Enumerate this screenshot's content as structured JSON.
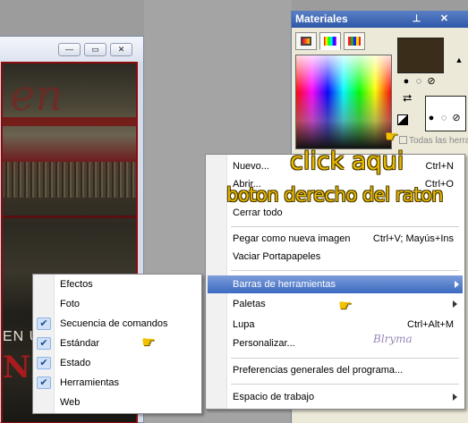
{
  "doc_window": {
    "buttons": [
      "—",
      "▭",
      "✕"
    ],
    "text_fragments": {
      "top": "en",
      "middle": "EN U",
      "bottom": "NI"
    }
  },
  "materials": {
    "title": "Materiales",
    "titlebar_icons": [
      "pin-icon",
      "close-icon"
    ],
    "tabs": [
      "frame-tab",
      "rainbow-tab",
      "swatches-tab"
    ],
    "fg_color": "#3a2e1a",
    "bg_color": "#ffffff",
    "todas_label": "Todas las herra"
  },
  "context_menu": {
    "items": [
      {
        "label": "Nuevo...",
        "shortcut": "Ctrl+N"
      },
      {
        "label": "Abrir...",
        "shortcut": "Ctrl+O"
      },
      {
        "label": "Cerrar todo",
        "shortcut": ""
      },
      {
        "label": "Pegar como nueva imagen",
        "shortcut": "Ctrl+V; Mayús+Ins"
      },
      {
        "label": "Vaciar Portapapeles",
        "shortcut": ""
      },
      {
        "label": "Barras de herramientas",
        "shortcut": ""
      },
      {
        "label": "Paletas",
        "shortcut": ""
      },
      {
        "label": "Lupa",
        "shortcut": "Ctrl+Alt+M"
      },
      {
        "label": "Personalizar...",
        "shortcut": ""
      },
      {
        "label": "Preferencias generales del programa...",
        "shortcut": ""
      },
      {
        "label": "Espacio de trabajo",
        "shortcut": ""
      }
    ]
  },
  "submenu": {
    "items": [
      {
        "label": "Efectos",
        "checked": false
      },
      {
        "label": "Foto",
        "checked": false
      },
      {
        "label": "Secuencia de comandos",
        "checked": true
      },
      {
        "label": "Estándar",
        "checked": true
      },
      {
        "label": "Estado",
        "checked": true
      },
      {
        "label": "Herramientas",
        "checked": true
      },
      {
        "label": "Web",
        "checked": false
      }
    ]
  },
  "annotations": {
    "click": "click aqui",
    "boton": "boton derecho del raton",
    "signature": "Blryma"
  },
  "colors": {
    "highlight": "#3c6ac1",
    "annotation": "#e7b800",
    "titlebar": "#2e58a8"
  }
}
